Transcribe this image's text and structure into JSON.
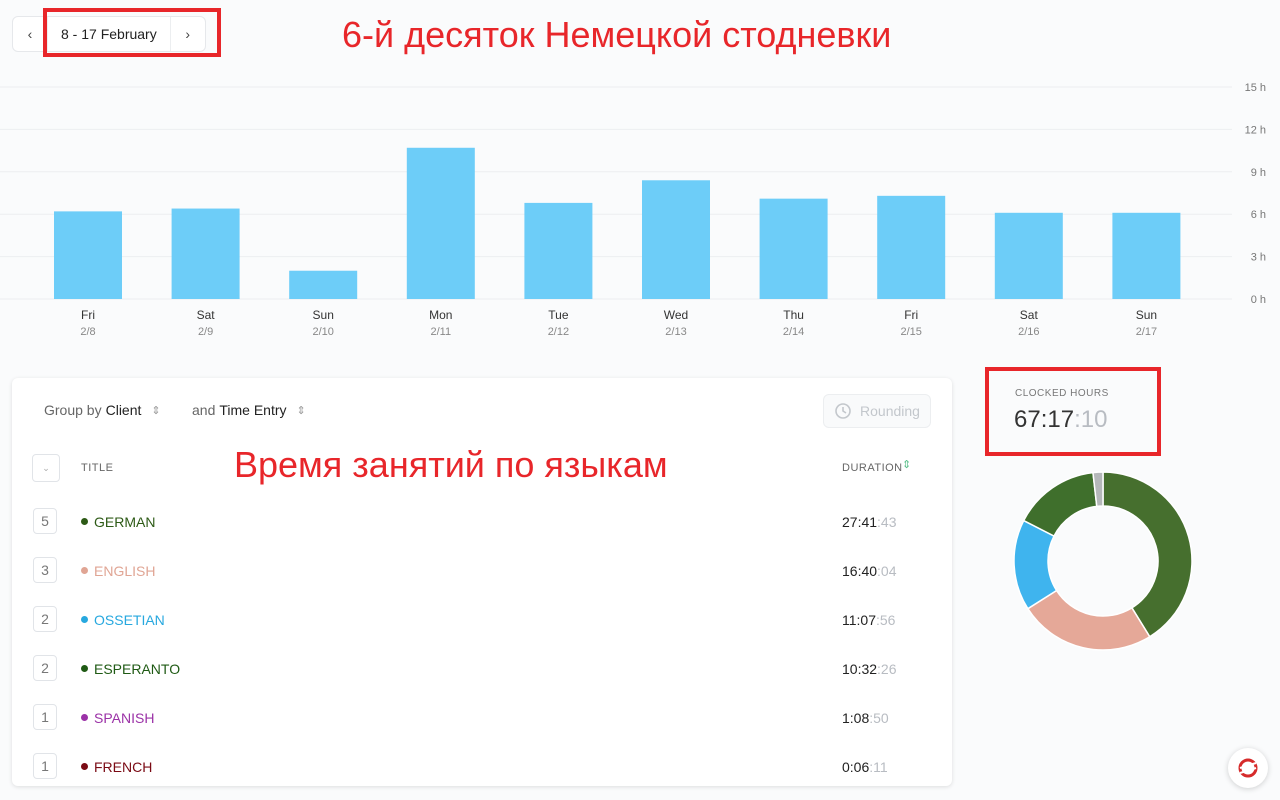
{
  "date_nav": {
    "range": "8 - 17 February",
    "prev_icon": "‹",
    "next_icon": "›"
  },
  "annotations": {
    "title": "6-й десяток Немецкой стодневки",
    "table_note": "Время занятий по языкам"
  },
  "chart_data": {
    "type": "bar",
    "categories": [
      "Fri",
      "Sat",
      "Sun",
      "Mon",
      "Tue",
      "Wed",
      "Thu",
      "Fri",
      "Sat",
      "Sun"
    ],
    "dates": [
      "2/8",
      "2/9",
      "2/10",
      "2/11",
      "2/12",
      "2/13",
      "2/14",
      "2/15",
      "2/16",
      "2/17"
    ],
    "values": [
      6.2,
      6.4,
      2.0,
      10.7,
      6.8,
      8.4,
      7.1,
      7.3,
      6.1,
      6.1
    ],
    "y_ticks": [
      "0 h",
      "3 h",
      "6 h",
      "9 h",
      "12 h",
      "15 h"
    ],
    "ylim": [
      0,
      15
    ],
    "color": "#6dcdf8",
    "grid": true
  },
  "table": {
    "group_by_label": "Group by",
    "group_by_value": "Client",
    "and_label": "and",
    "and_value": "Time Entry",
    "rounding_label": "Rounding",
    "col_title": "TITLE",
    "col_duration": "DURATION",
    "rows": [
      {
        "count": "5",
        "name": "GERMAN",
        "color": "#2d5a16",
        "dur_main": "27:41",
        "dur_sec": ":43"
      },
      {
        "count": "3",
        "name": "ENGLISH",
        "color": "#e0a594",
        "dur_main": "16:40",
        "dur_sec": ":04"
      },
      {
        "count": "2",
        "name": "OSSETIAN",
        "color": "#27a8df",
        "dur_main": "11:07",
        "dur_sec": ":56"
      },
      {
        "count": "2",
        "name": "ESPERANTO",
        "color": "#1f5a14",
        "dur_main": "10:32",
        "dur_sec": ":26"
      },
      {
        "count": "1",
        "name": "SPANISH",
        "color": "#9b32a7",
        "dur_main": "1:08",
        "dur_sec": ":50"
      },
      {
        "count": "1",
        "name": "FRENCH",
        "color": "#7a0a14",
        "dur_main": "0:06",
        "dur_sec": ":11"
      }
    ]
  },
  "clocked": {
    "label": "CLOCKED HOURS",
    "main": "67:17",
    "sec": ":10"
  },
  "donut": {
    "segments": [
      {
        "name": "German",
        "fraction": 0.412,
        "color": "#466f2e"
      },
      {
        "name": "English",
        "fraction": 0.248,
        "color": "#e5a898"
      },
      {
        "name": "Ossetian",
        "fraction": 0.165,
        "color": "#3fb4ee"
      },
      {
        "name": "Esperanto",
        "fraction": 0.157,
        "color": "#3f6f2c"
      },
      {
        "name": "Other",
        "fraction": 0.018,
        "color": "#b5b8ba"
      }
    ]
  }
}
